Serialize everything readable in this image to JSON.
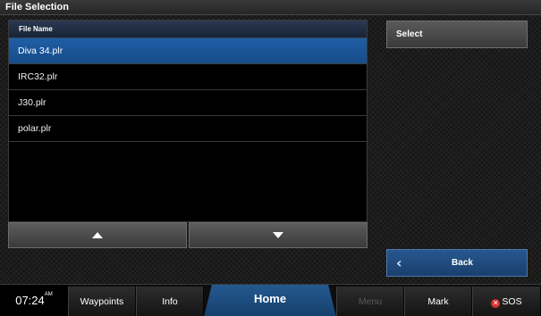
{
  "window": {
    "title": "File Selection"
  },
  "file_list": {
    "column_header": "File Name",
    "files": [
      "Diva 34.plr",
      "IRC32.plr",
      "J30.plr",
      "polar.plr"
    ],
    "selected_index": 0
  },
  "actions": {
    "select_label": "Select",
    "back_label": "Back"
  },
  "status": {
    "time": "07:24",
    "ampm": "AM"
  },
  "nav": {
    "waypoints": "Waypoints",
    "info": "Info",
    "home": "Home",
    "menu": "Menu",
    "mark": "Mark",
    "sos": "SOS"
  },
  "colors": {
    "accent_blue": "#1f5ea6",
    "header_blue": "#2b3a52",
    "sos_red": "#d62e2e"
  }
}
